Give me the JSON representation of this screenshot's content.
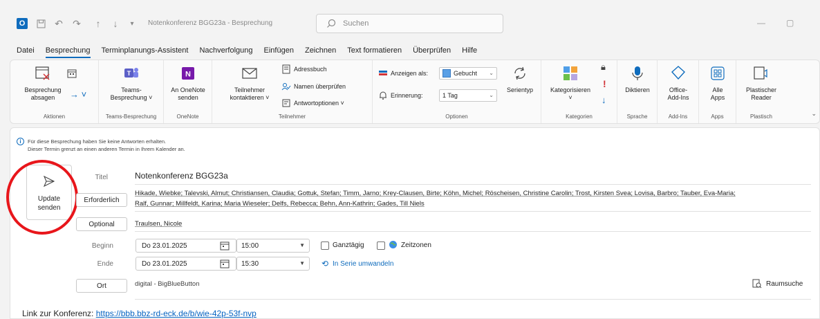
{
  "window": {
    "title": "Notenkonferenz BGG23a  -  Besprechung",
    "search_placeholder": "Suchen",
    "minimize": "—",
    "restore": "▢"
  },
  "menu": [
    "Datei",
    "Besprechung",
    "Terminplanungs-Assistent",
    "Nachverfolgung",
    "Einfügen",
    "Zeichnen",
    "Text formatieren",
    "Überprüfen",
    "Hilfe"
  ],
  "ribbon": {
    "aktionen": {
      "label": "Aktionen",
      "absagen": "Besprechung\nabsagen",
      "forward": "→ ˅"
    },
    "teams": {
      "label": "Teams-Besprechung",
      "btn": "Teams-\nBesprechung ˅"
    },
    "onenote": {
      "label": "OneNote",
      "btn": "An OneNote\nsenden"
    },
    "teilnehmer": {
      "label": "Teilnehmer",
      "kontakt": "Teilnehmer\nkontaktieren ˅",
      "adressbuch": "Adressbuch",
      "namen": "Namen überprüfen",
      "antwort": "Antwortoptionen ˅"
    },
    "optionen": {
      "label": "Optionen",
      "anzeigen": "Anzeigen als:",
      "anzeigen_value": "Gebucht",
      "erinnerung": "Erinnerung:",
      "erinnerung_value": "1 Tag",
      "serientyp": "Serientyp"
    },
    "kategorien": {
      "label": "Kategorien",
      "btn": "Kategorisieren\n˅"
    },
    "sprache": {
      "label": "Sprache",
      "btn": "Diktieren"
    },
    "addins": {
      "label": "Add-Ins",
      "btn": "Office-\nAdd-Ins"
    },
    "apps": {
      "label": "Apps",
      "btn": "Alle\nApps"
    },
    "plastisch": {
      "label": "Plastisch",
      "btn": "Plastischer\nReader"
    }
  },
  "info": {
    "line1": "Für diese Besprechung haben Sie keine Antworten erhalten.",
    "line2": "Dieser Termin grenzt an einen anderen Termin in Ihrem Kalender an."
  },
  "form": {
    "send_label": "Update\nsenden",
    "titel_label": "Titel",
    "titel_value": "Notenkonferenz BGG23a",
    "erforderlich_label": "Erforderlich",
    "attendees_line1": "Hikade, Wiebke; Talevski, Almut; Christiansen, Claudia; Gottuk, Stefan; Timm, Jarno; Krey-Clausen, Birte; Köhn, Michel; Röscheisen, Christine Carolin; Trost, Kirsten Svea; Lovisa, Barbro; Tauber, Eva-Maria;",
    "attendees_line2": "Ralf, Gunnar; Millfeldt, Karina; Maria Wieseler; Delfs, Rebecca; Behn, Ann-Kathrin; Gades, Till Niels",
    "optional_label": "Optional",
    "optional_value": "Traulsen, Nicole",
    "beginn_label": "Beginn",
    "beginn_date": "Do 23.01.2025",
    "beginn_time": "15:00",
    "ganztaegig": "Ganztägig",
    "zeitzonen": "Zeitzonen",
    "ende_label": "Ende",
    "ende_date": "Do 23.01.2025",
    "ende_time": "15:30",
    "serie": "In Serie umwandeln",
    "ort_label": "Ort",
    "ort_value": "digital - BigBlueButton",
    "raumsuche": "Raumsuche"
  },
  "body": {
    "prefix": "Link zur Konferenz: ",
    "link": "https://bbb.bbz-rd-eck.de/b/wie-42p-53f-nvp"
  },
  "colors": {
    "accent": "#0f6cbd",
    "highlight_circle": "#e8161b"
  }
}
